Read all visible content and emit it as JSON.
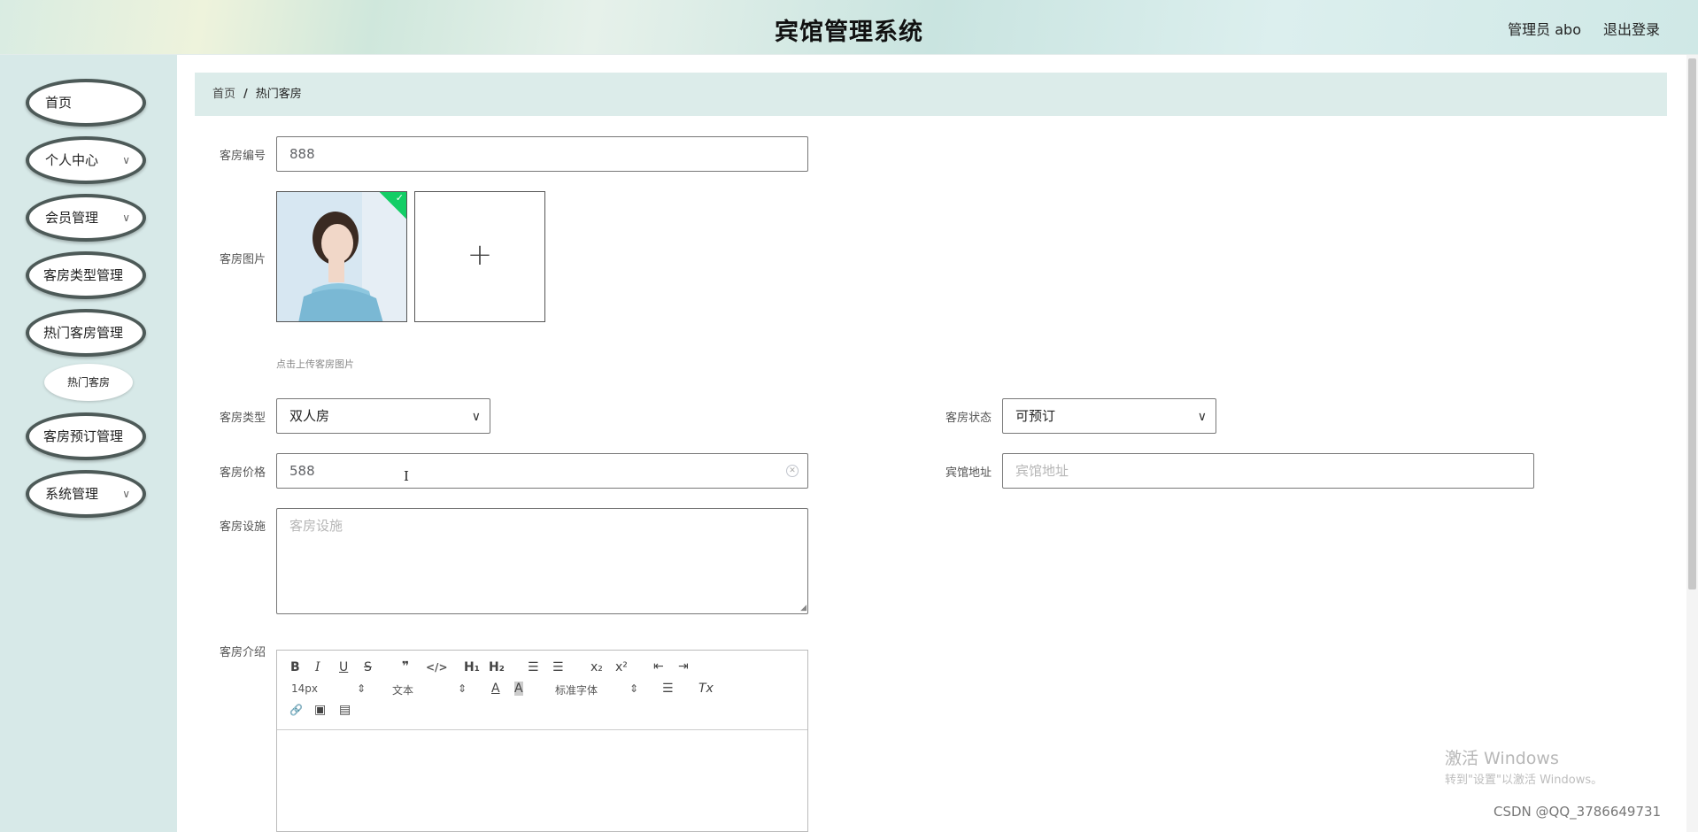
{
  "header": {
    "title": "宾馆管理系统",
    "admin_label": "管理员 abo",
    "logout_label": "退出登录"
  },
  "sidebar": {
    "items": [
      {
        "label": "首页",
        "has_arrow": false
      },
      {
        "label": "个人中心",
        "has_arrow": true
      },
      {
        "label": "会员管理",
        "has_arrow": true
      },
      {
        "label": "客房类型管理",
        "has_arrow": false
      },
      {
        "label": "热门客房管理",
        "has_arrow": false
      },
      {
        "label": "客房预订管理",
        "has_arrow": false
      },
      {
        "label": "系统管理",
        "has_arrow": true
      }
    ],
    "sub_item": "热门客房",
    "arrow_glyph": "∨"
  },
  "breadcrumb": {
    "home": "首页",
    "separator": "/",
    "current": "热门客房"
  },
  "form": {
    "room_number": {
      "label": "客房编号",
      "value": "888"
    },
    "room_image": {
      "label": "客房图片",
      "tip": "点击上传客房图片",
      "add_glyph": "+"
    },
    "room_type": {
      "label": "客房类型",
      "value": "双人房"
    },
    "room_status": {
      "label": "客房状态",
      "value": "可预订"
    },
    "room_price": {
      "label": "客房价格",
      "value": "588"
    },
    "hotel_address": {
      "label": "宾馆地址",
      "placeholder": "宾馆地址"
    },
    "room_facilities": {
      "label": "客房设施",
      "placeholder": "客房设施"
    },
    "room_intro": {
      "label": "客房介绍"
    }
  },
  "editor": {
    "bold": "B",
    "italic": "I",
    "underline": "U",
    "strike": "S",
    "quote": "❞",
    "code": "</>",
    "h1": "H₁",
    "h2": "H₂",
    "ordered_list": "☰",
    "bullet_list": "☰",
    "subscript": "x₂",
    "superscript": "x²",
    "outdent": "⇤",
    "indent": "⇥",
    "font_size": "14px",
    "text_style": "文本",
    "font_family": "标准字体",
    "font_color": "A",
    "bg_color": "A",
    "align": "☰",
    "clear_format": "Tx",
    "link": "🔗",
    "image": "▣",
    "video": "▤",
    "select_arrow": "⇕"
  },
  "watermark": {
    "line1": "激活 Windows",
    "line2": "转到\"设置\"以激活 Windows。"
  },
  "csdn": "CSDN @QQ_3786649731"
}
